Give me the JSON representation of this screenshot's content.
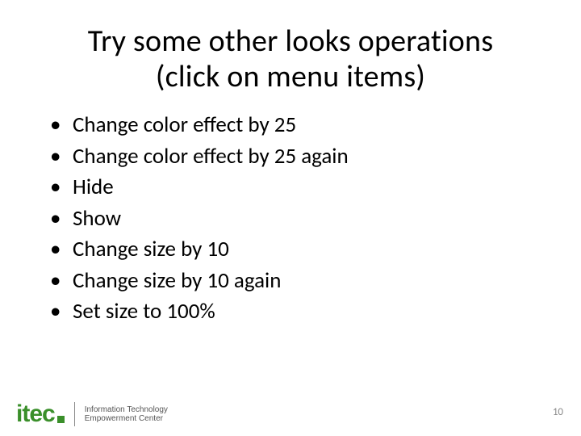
{
  "title_line1": "Try some other looks operations",
  "title_line2": "(click on menu items)",
  "bullets": [
    "Change color effect by 25",
    "Change color effect by 25 again",
    "Hide",
    "Show",
    "Change size by 10",
    "Change size by 10 again",
    "Set size to 100%"
  ],
  "logo": {
    "mark": "itec",
    "text_line1": "Information Technology",
    "text_line2": "Empowerment Center"
  },
  "page_number": "10"
}
